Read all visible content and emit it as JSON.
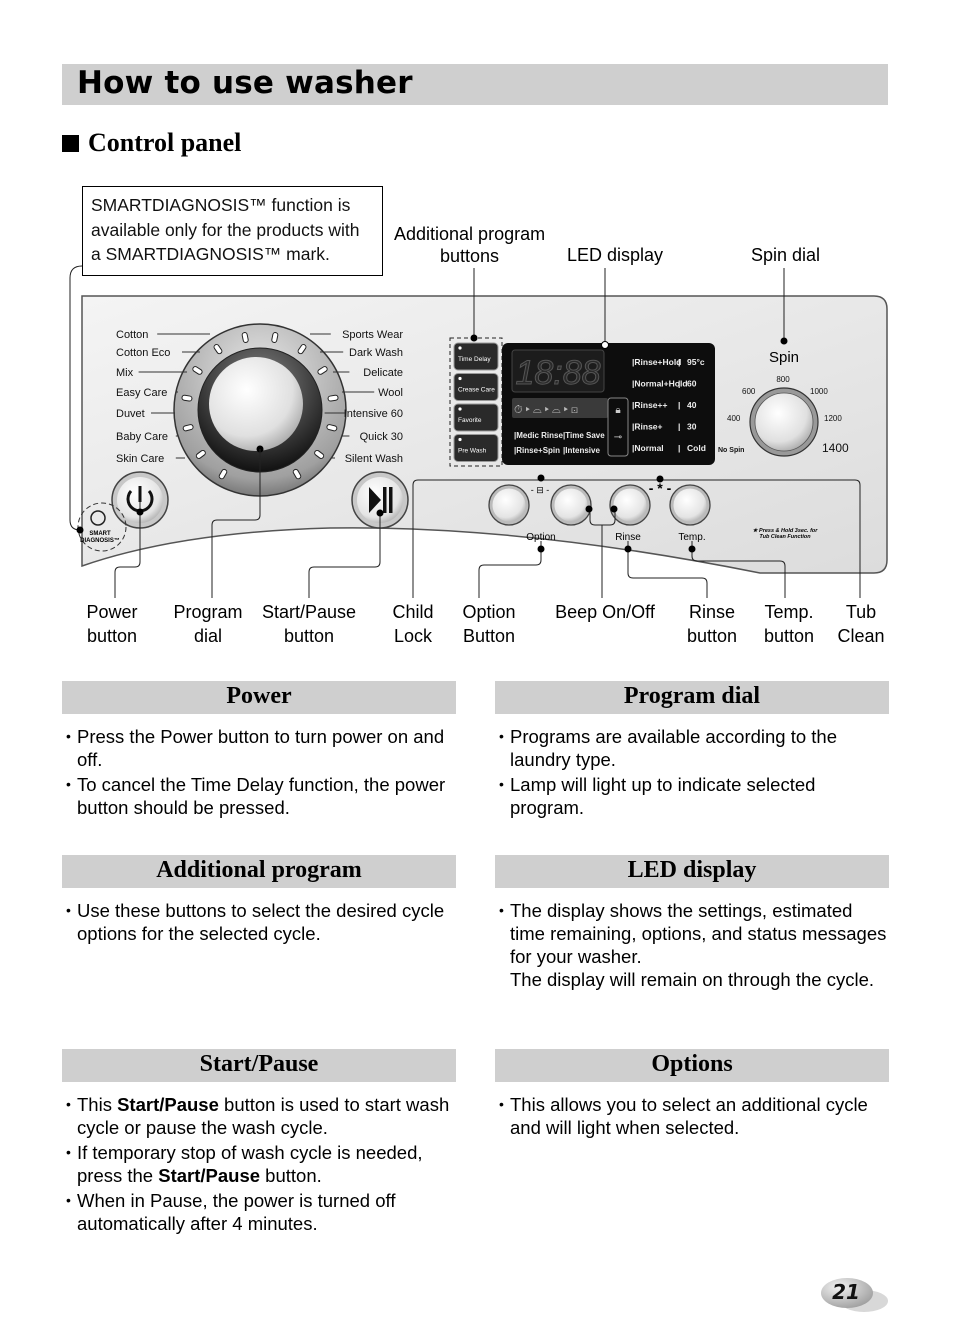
{
  "header": {
    "title": "How to use washer",
    "section": "Control panel"
  },
  "note": "SMARTDIAGNOSIS™ function is available only for the products with a SMARTDIAGNOSIS™ mark.",
  "top_callouts": {
    "additional_program": [
      "Additional program",
      "buttons"
    ],
    "led_display": "LED display",
    "spin_dial": "Spin dial"
  },
  "panel": {
    "programs_left": [
      "Cotton",
      "Cotton Eco",
      "Mix",
      "Easy Care",
      "Duvet",
      "Baby Care",
      "Skin Care"
    ],
    "programs_right": [
      "Sports Wear",
      "Dark Wash",
      "Delicate",
      "Wool",
      "Intensive 60",
      "Quick 30",
      "Silent Wash"
    ],
    "additional_buttons": [
      "Time Delay",
      "Crease Care",
      "Favorite",
      "Pre Wash"
    ],
    "led_digits": "18:88",
    "led_options_left": [
      "Medic Rinse",
      "Rinse+Spin"
    ],
    "led_options_right": [
      "Time Save",
      "Intensive"
    ],
    "rinse_levels": [
      "Rinse+Hold",
      "Normal+Hold",
      "Rinse++",
      "Rinse+",
      "Normal"
    ],
    "temperatures": [
      "95°c",
      "60",
      "40",
      "30",
      "Cold"
    ],
    "spin_title": "Spin",
    "spin_values": [
      "No Spin",
      "400",
      "600",
      "800",
      "1000",
      "1200",
      "1400"
    ],
    "option_label": "Option",
    "rinse_label": "Rinse",
    "temp_label": "Temp.",
    "tub_clean_note": [
      "★ Press & Hold 3sec. for",
      "Tub Clean Function"
    ],
    "smart_label": [
      "SMART",
      "DIAGNOSIS™"
    ]
  },
  "bottom_callouts": [
    [
      "Power",
      "button"
    ],
    [
      "Program",
      "dial"
    ],
    [
      "Start/Pause",
      "button"
    ],
    [
      "Child",
      "Lock"
    ],
    [
      "Option",
      "Button"
    ],
    [
      "Beep On/Off",
      ""
    ],
    [
      "Rinse",
      "button"
    ],
    [
      "Temp.",
      "button"
    ],
    [
      "Tub",
      "Clean"
    ]
  ],
  "sections": {
    "power": {
      "title": "Power",
      "bullets": [
        "Press the Power button to turn power on and off.",
        "To cancel the Time Delay function, the power button should be pressed."
      ]
    },
    "program_dial": {
      "title": "Program dial",
      "bullets": [
        "Programs are available according to the laundry type.",
        "Lamp will light up to indicate selected program."
      ]
    },
    "additional_program": {
      "title": "Additional program",
      "bullets": [
        "Use these buttons to select the desired cycle options for the selected cycle."
      ]
    },
    "led_display": {
      "title": "LED display",
      "bullets": [
        "The display shows the settings, estimated time remaining, options, and status messages for your washer.\nThe display will remain on through the cycle."
      ]
    },
    "start_pause": {
      "title": "Start/Pause",
      "bullets": [
        [
          "This ",
          {
            "b": "Start/Pause"
          },
          " button is used to start wash cycle or pause the wash cycle."
        ],
        [
          "If temporary stop of wash cycle is needed, press the ",
          {
            "b": "Start/Pause"
          },
          " button."
        ],
        [
          "When in Pause, the power is turned off automatically after 4 minutes."
        ]
      ]
    },
    "options": {
      "title": "Options",
      "bullets": [
        "This allows you to select an additional cycle and will light when selected."
      ]
    }
  },
  "page_number": "21"
}
